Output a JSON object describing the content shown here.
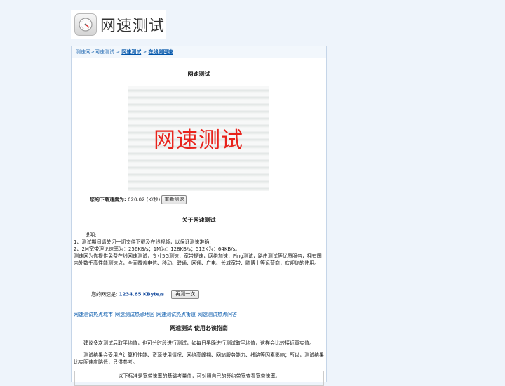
{
  "logo": {
    "icon": "speed-gauge-icon",
    "text": "网速测试"
  },
  "breadcrumb": {
    "home": "测速网>网速测试",
    "sep1": " > ",
    "link1": "网速测试",
    "sep2": " > ",
    "link2": "在线测网速"
  },
  "speedtest": {
    "title": "网速测试",
    "banner_text": "网速测试",
    "download_label": "您的下载速度为:",
    "download_value": "620.02 (K/秒)",
    "retest_button": "重新测速"
  },
  "about": {
    "title": "关于网速测试",
    "intro": "说明:",
    "lines": [
      "1、测试期间请关闭一切文件下载及在线视频，以保证测速准确;",
      "2、2M宽带理论速率为：256KB/s；1M为：128KB/s；512K为：64KB/s。"
    ],
    "desc": "测速网为你提供免费在线网速测试，专业5G测速，宽带提速，网络加速，Ping测试，路由测试等优质服务，拥有国内外数千高性能测速点，全面覆盖电信、移动、联通、网通、广电、长城宽带、鹏博士等运营商，欢迎你的使用。",
    "speed_label": "您的网速是:",
    "speed_value": "1234.65 KByte/s",
    "retest_button": "再测一次"
  },
  "hot_links": [
    "网速测试热点城市",
    "网速测试热点地区",
    "网速测试热点街道",
    "网速测试热点问答"
  ],
  "guide": {
    "title": "网速测试 使用必读指南",
    "p1": "建议多次测试后取平均值，也可分时段进行测试，如每日早晚进行测试取平均值，这样会比较接近真实值。",
    "p2": "测试结果会受用户计算机性能、资源使用情况、网络高峰期、网站服务能力、线路等因素影响；所以，测试结果比实际速度略低，只供参考。",
    "notice": "以下标准是宽带速率的基础考量值，可对照自己的签约带宽查看宽带速率。"
  },
  "colors": {
    "accent_red": "#e8231c",
    "link_blue": "#0055aa",
    "speed_blue": "#1a4fa0",
    "divider_red": "#d9392f"
  }
}
